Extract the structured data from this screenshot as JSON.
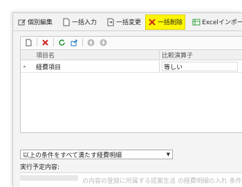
{
  "toolbar": {
    "items": [
      {
        "label": "個別編集",
        "icon": "edit-icon"
      },
      {
        "label": "一括入力",
        "icon": "doc-icon"
      },
      {
        "label": "一括変更",
        "icon": "doc-arrow-icon"
      },
      {
        "label": "一括削除",
        "icon": "x-icon"
      },
      {
        "label": "Excelインポート",
        "icon": "excel-icon"
      }
    ],
    "highlight_color": "#fff700"
  },
  "grid": {
    "headers": [
      "項目名",
      "比較演算子"
    ],
    "rows": [
      {
        "field": "経費項目",
        "operator": "等しい"
      }
    ]
  },
  "condition_select": {
    "value": "以上の条件をすべて満たす経費明細"
  },
  "exec": {
    "label": "実行予定内容:",
    "text": "の内容の登録に所属する提案生活 の経費明細の入れ 条件「経費項"
  },
  "colors": {
    "delete_red": "#d0211c",
    "refresh_green": "#2e9a3a",
    "accent_blue": "#1a6fc0"
  }
}
